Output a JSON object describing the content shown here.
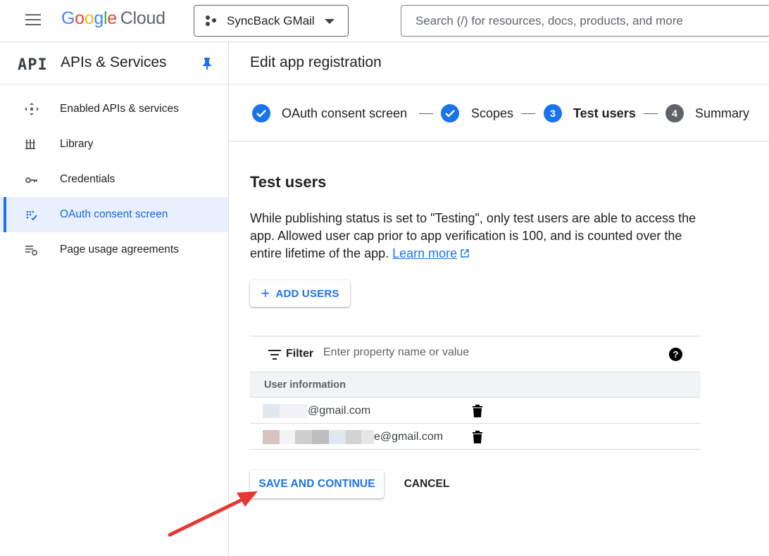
{
  "topbar": {
    "logo_letters": [
      "G",
      "o",
      "o",
      "g",
      "l",
      "e"
    ],
    "logo_product": "Cloud",
    "project_name": "SyncBack GMail",
    "search_placeholder": "Search (/) for resources, docs, products, and more"
  },
  "sidebar": {
    "logo_text": "API",
    "title": "APIs & Services",
    "items": [
      {
        "label": "Enabled APIs & services",
        "icon": "enabled-apis-icon"
      },
      {
        "label": "Library",
        "icon": "library-icon"
      },
      {
        "label": "Credentials",
        "icon": "key-icon"
      },
      {
        "label": "OAuth consent screen",
        "icon": "oauth-consent-icon",
        "active": true
      },
      {
        "label": "Page usage agreements",
        "icon": "page-settings-icon"
      }
    ]
  },
  "main": {
    "title": "Edit app registration",
    "steps": [
      {
        "label": "OAuth consent screen",
        "state": "done"
      },
      {
        "label": "Scopes",
        "state": "done"
      },
      {
        "number": "3",
        "label": "Test users",
        "state": "current"
      },
      {
        "number": "4",
        "label": "Summary",
        "state": "todo"
      }
    ],
    "section_title": "Test users",
    "description": "While publishing status is set to \"Testing\", only test users are able to access the app. Allowed user cap prior to app verification is 100, and is counted over the entire lifetime of the app.",
    "learn_more": "Learn more",
    "add_users_label": "ADD USERS",
    "filter_label": "Filter",
    "filter_placeholder": "Enter property name or value",
    "table_header": "User information",
    "users": [
      {
        "email_visible": "@gmail.com"
      },
      {
        "email_visible": "e@gmail.com"
      }
    ],
    "save_label": "SAVE AND CONTINUE",
    "cancel_label": "CANCEL"
  },
  "colors": {
    "accent": "#1a73e8",
    "annotation_arrow": "#e53935"
  }
}
